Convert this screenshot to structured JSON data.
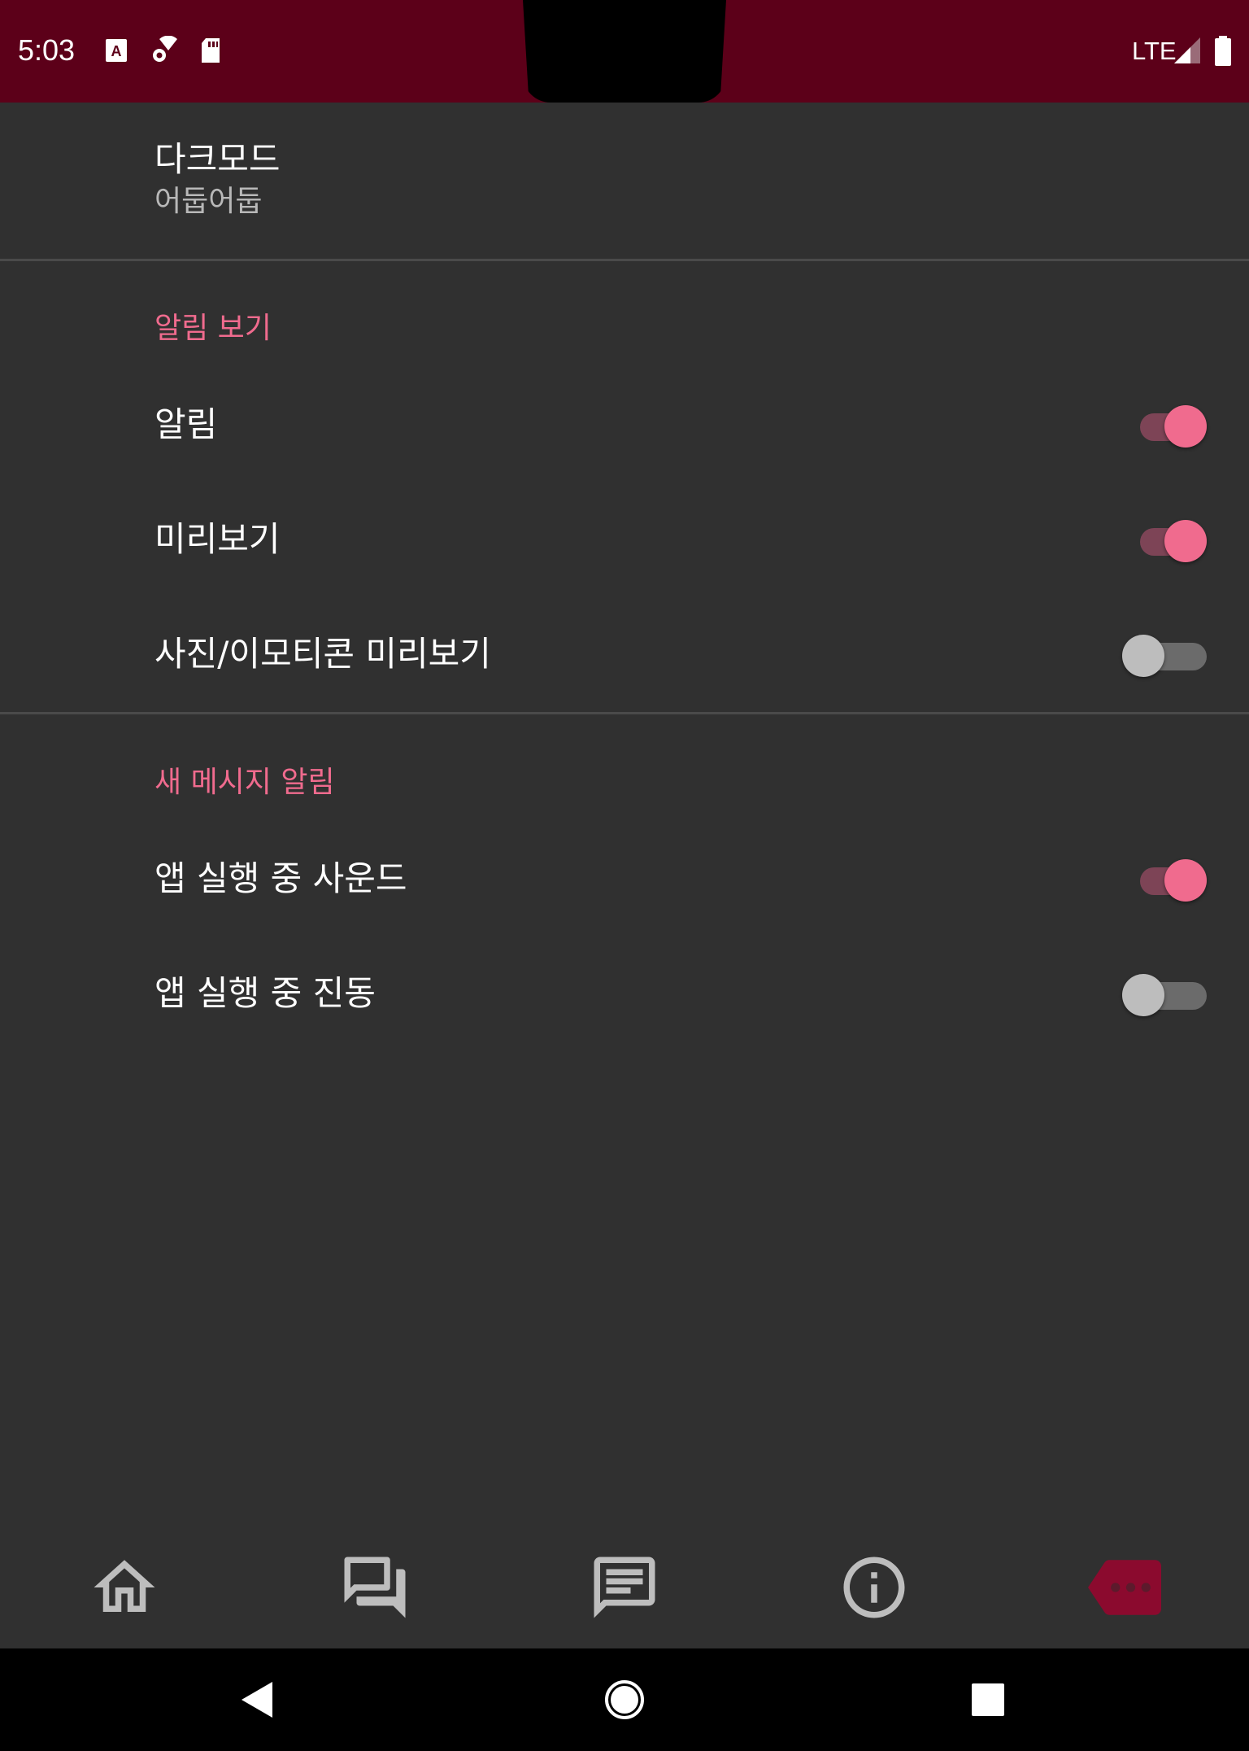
{
  "status_bar": {
    "time": "5:03",
    "network": "LTE",
    "icons": [
      "font-a-icon",
      "settings-wifi-icon",
      "sd-card-icon",
      "signal-icon",
      "battery-icon"
    ],
    "background_color": "#5c0019"
  },
  "settings": {
    "dark_mode": {
      "title": "다크모드",
      "summary": "어둡어둡"
    },
    "categories": [
      {
        "title": "알림 보기",
        "items": [
          {
            "label": "알림",
            "checked": true
          },
          {
            "label": "미리보기",
            "checked": true
          },
          {
            "label": "사진/이모티콘 미리보기",
            "checked": false
          }
        ]
      },
      {
        "title": "새 메시지 알림",
        "items": [
          {
            "label": "앱 실행 중 사운드",
            "checked": true
          },
          {
            "label": "앱 실행 중 진동",
            "checked": false
          }
        ]
      }
    ]
  },
  "bottom_nav": {
    "items": [
      "home-icon",
      "forum-icon",
      "message-icon",
      "info-icon",
      "more-label-icon"
    ],
    "selected": "more-label-icon",
    "accent_color": "#8b0a2e",
    "inactive_color": "#bdbdbd"
  },
  "system_nav": [
    "back-icon",
    "home-circle-icon",
    "recents-icon"
  ],
  "colors": {
    "background": "#303030",
    "category": "#f06b8e",
    "switch_on": "#f06b8e"
  }
}
